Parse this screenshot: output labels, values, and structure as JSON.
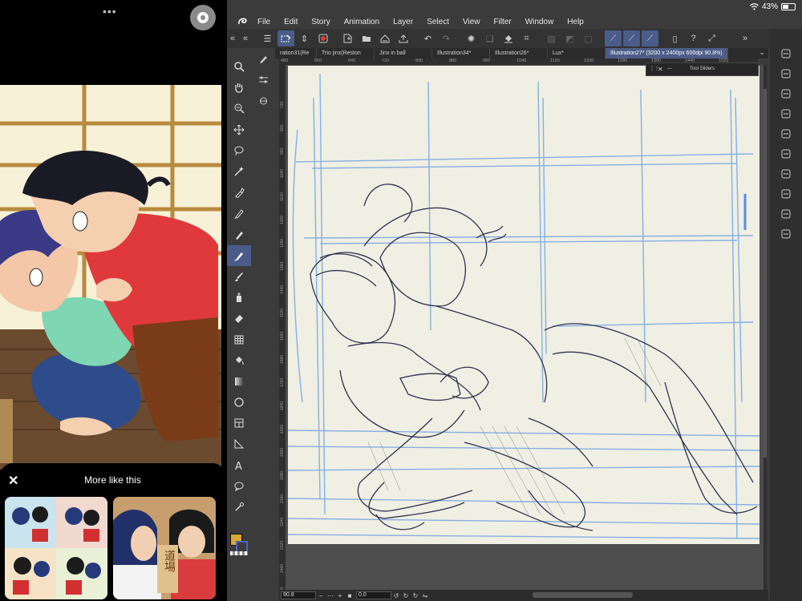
{
  "status": {
    "battery": "43%"
  },
  "menu": [
    "File",
    "Edit",
    "Story",
    "Animation",
    "Layer",
    "Select",
    "View",
    "Filter",
    "Window",
    "Help"
  ],
  "tabs": [
    {
      "label": "ration31(Re"
    },
    {
      "label": "Trio jinx(Reston"
    },
    {
      "label": "Jinx in ball"
    },
    {
      "label": "Illustration34*"
    },
    {
      "label": "Illustration26*"
    },
    {
      "label": "Lux*"
    },
    {
      "label": "Illustration27* (3200 x 2400px 600dpi 90.8%)",
      "active": true
    }
  ],
  "tool_sliders": {
    "title": "Tool Sliders"
  },
  "ruler_top": [
    "480",
    "560",
    "640",
    "720",
    "800",
    "880",
    "960",
    "1040",
    "1120",
    "1200",
    "1280",
    "1360",
    "1440",
    "1520"
  ],
  "ruler_left": [
    "720",
    "800",
    "960",
    "1040",
    "1120",
    "1200",
    "1280",
    "1360",
    "1440",
    "1520",
    "1600",
    "1680",
    "1760",
    "1840",
    "1920",
    "2000",
    "2080",
    "2160",
    "2240",
    "2320",
    "2400",
    "2480"
  ],
  "bottom": {
    "zoom": "90.8",
    "angle": "0.0"
  },
  "sheet": {
    "title": "More like this"
  },
  "thumb_text": "道場",
  "colors": {
    "main": "#d9a833",
    "accent": "#4b5c8a"
  },
  "icons": {
    "left_tools": [
      "zoom",
      "hand",
      "rotate",
      "move",
      "lasso",
      "wand",
      "eyedropper",
      "pen",
      "pencil",
      "pen-active",
      "brush",
      "airbrush",
      "eraser",
      "grid",
      "fill",
      "gradient",
      "ellipse",
      "frame",
      "ruler",
      "text",
      "balloon",
      "correction"
    ],
    "right_tools": [
      "layers",
      "auto-actions",
      "navigator",
      "layer-property",
      "material",
      "animation",
      "history",
      "sub-view",
      "item-bank",
      "color-set"
    ]
  }
}
